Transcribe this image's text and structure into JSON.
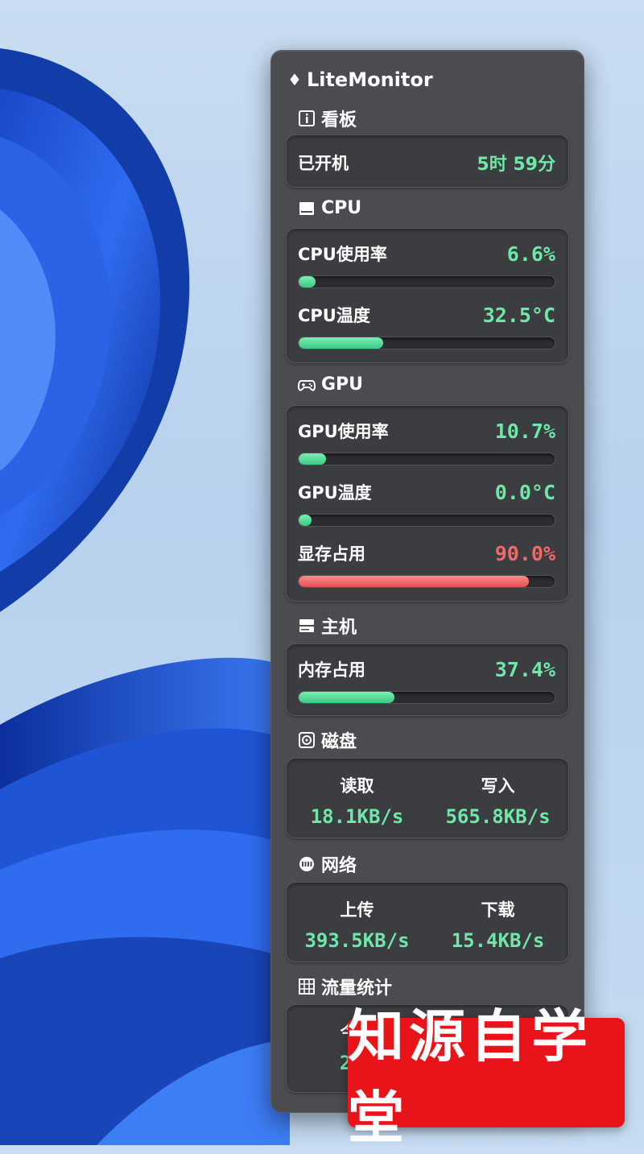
{
  "app": {
    "title": "LiteMonitor"
  },
  "dashboard": {
    "header": "看板",
    "uptime_label": "已开机",
    "uptime_value": "5时 59分"
  },
  "cpu": {
    "header": "CPU",
    "usage_label": "CPU使用率",
    "usage_value": "6.6%",
    "usage_fraction": 0.066,
    "temp_label": "CPU温度",
    "temp_value": "32.5°C",
    "temp_fraction": 0.33
  },
  "gpu": {
    "header": "GPU",
    "usage_label": "GPU使用率",
    "usage_value": "10.7%",
    "usage_fraction": 0.107,
    "temp_label": "GPU温度",
    "temp_value": "0.0°C",
    "temp_fraction": 0.0,
    "vram_label": "显存占用",
    "vram_value": "90.0%",
    "vram_fraction": 0.9
  },
  "host": {
    "header": "主机",
    "mem_label": "内存占用",
    "mem_value": "37.4%",
    "mem_fraction": 0.374
  },
  "disk": {
    "header": "磁盘",
    "read_label": "读取",
    "read_value": "18.1KB/s",
    "write_label": "写入",
    "write_value": "565.8KB/s"
  },
  "network": {
    "header": "网络",
    "up_label": "上传",
    "up_value": "393.5KB/s",
    "down_label": "下载",
    "down_value": "15.4KB/s"
  },
  "traffic": {
    "header": "流量统计",
    "today_label": "今日",
    "today_value_partial": "28."
  },
  "watermark": {
    "text": "知源自学堂"
  },
  "colors": {
    "panel": "#4a4c50",
    "card": "#3b3d41",
    "value_green": "#6ee7a8",
    "value_red": "#f2696a",
    "bar_green": "#3cc883",
    "bar_red": "#e24f52",
    "watermark_bg": "#e8141a"
  },
  "icons": {
    "dashboard": "info-icon",
    "cpu": "cpu-icon",
    "gpu": "gamepad-icon",
    "host": "server-icon",
    "disk": "disk-icon",
    "network": "network-icon",
    "traffic": "grid-chart-icon"
  }
}
